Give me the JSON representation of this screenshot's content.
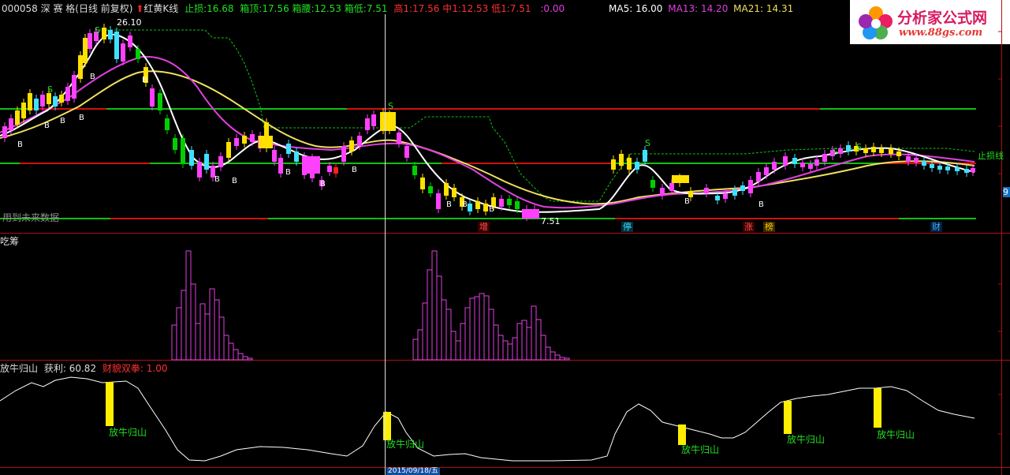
{
  "header": {
    "symbol": "000058",
    "name": "深 赛 格",
    "period": "(日线 前复权)",
    "indicator_name": "红黄K线",
    "stoploss_label": "止损:",
    "stoploss_value": "16.68",
    "box_top_label": "箱顶:",
    "box_top_value": "17.56",
    "box_mid_label": "箱腰:",
    "box_mid_value": "12.53",
    "box_low_label": "箱低:",
    "box_low_value": "7.51",
    "high1_label": "高1:",
    "high1_value": "17.56",
    "mid1_label": "中1:",
    "mid1_value": "12.53",
    "low1_label": "低1:",
    "low1_value": "7.51",
    "extra_value": ":0.00",
    "ma5_label": "MA5:",
    "ma5_value": "16.00",
    "ma13_label": "MA13:",
    "ma13_value": "14.20",
    "ma21_label": "MA21:",
    "ma21_value": "14.31"
  },
  "main_panel": {
    "peak_label": "26.10",
    "trough_label": "7.51",
    "future_data_label": "用到未来数据",
    "stoploss_line_label": "止损线",
    "right_edge_label": "9",
    "event_tags": [
      {
        "text": "增",
        "color": "#ff4040"
      },
      {
        "text": "停",
        "color": "#40e0ff"
      },
      {
        "text": "涨",
        "color": "#ff4040"
      },
      {
        "text": "榜",
        "color": "#ffcc00"
      },
      {
        "text": "财",
        "color": "#40b0ff"
      }
    ],
    "signal_S": "S",
    "signal_B": "B"
  },
  "chip_panel": {
    "title": "吃筹"
  },
  "bull_panel": {
    "title": "放牛归山",
    "profit_label": "获利:",
    "profit_value": "60.82",
    "dual_label": "财貌双拳:",
    "dual_value": "1.00",
    "signal_label": "放牛归山"
  },
  "bottom_axis": {
    "date_label": "2015/09/18/五"
  },
  "logo": {
    "title": "分析家公式网",
    "url": "www.88gs.com"
  },
  "colors": {
    "background": "#000000",
    "ma5": "#ffffff",
    "ma13": "#e040e0",
    "ma21": "#f0e060",
    "box_red": "#d01010",
    "box_green": "#10c010",
    "candle_yellow": "#ffe000",
    "candle_magenta": "#ff40ff",
    "candle_cyan": "#40e0ff",
    "candle_green": "#00d000",
    "chip_bar": "#e040e0",
    "bull_bar": "#ffee00",
    "stop_dash": "#10c010"
  }
}
